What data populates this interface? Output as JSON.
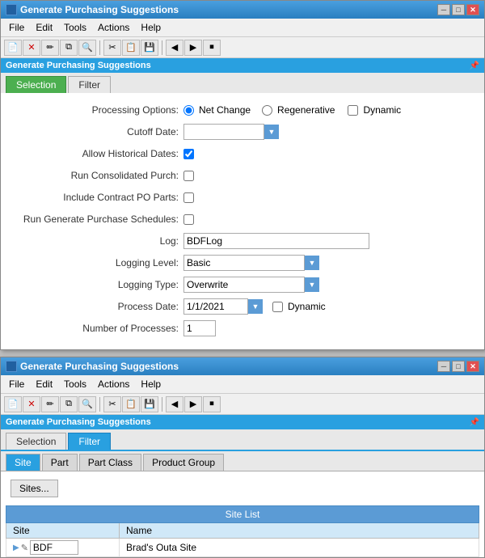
{
  "window1": {
    "title": "Generate Purchasing Suggestions",
    "section_title": "Generate Purchasing Suggestions",
    "tabs": [
      {
        "label": "Selection",
        "active": true,
        "type": "green"
      },
      {
        "label": "Filter",
        "active": false,
        "type": "inactive"
      }
    ],
    "menu": [
      "File",
      "Edit",
      "Tools",
      "Actions",
      "Help"
    ],
    "form": {
      "processing_options_label": "Processing Options:",
      "net_change_label": "Net Change",
      "regenerative_label": "Regenerative",
      "dynamic_label": "Dynamic",
      "cutoff_date_label": "Cutoff Date:",
      "allow_historical_label": "Allow Historical Dates:",
      "run_consolidated_label": "Run Consolidated Purch:",
      "include_contract_label": "Include Contract PO Parts:",
      "run_generate_label": "Run Generate Purchase Schedules:",
      "log_label": "Log:",
      "log_value": "BDFLog",
      "logging_level_label": "Logging Level:",
      "logging_level_value": "Basic",
      "logging_type_label": "Logging Type:",
      "logging_type_value": "Overwrite",
      "process_date_label": "Process Date:",
      "process_date_value": "1/1/2021",
      "process_dynamic_label": "Dynamic",
      "number_of_processes_label": "Number of Processes:",
      "number_of_processes_value": "1"
    }
  },
  "window2": {
    "title": "Generate Purchasing Suggestions",
    "section_title": "Generate Purchasing Suggestions",
    "tabs": [
      {
        "label": "Selection",
        "active": false,
        "type": "inactive"
      },
      {
        "label": "Filter",
        "active": true,
        "type": "cyan"
      }
    ],
    "menu": [
      "File",
      "Edit",
      "Tools",
      "Actions",
      "Help"
    ],
    "inner_tabs": [
      "Site",
      "Part",
      "Part Class",
      "Product Group"
    ],
    "active_inner_tab": "Site",
    "sites_button": "Sites...",
    "table": {
      "header": "Site List",
      "columns": [
        "Site",
        "Name"
      ],
      "rows": [
        {
          "site": "BDF",
          "name": "Brad's Outa Site"
        }
      ]
    }
  },
  "icons": {
    "new": "📄",
    "delete": "✕",
    "edit": "✏",
    "copy": "⧉",
    "paste": "📋",
    "cut": "✂",
    "save": "💾",
    "back": "◀",
    "forward": "▶",
    "stop": "⏹",
    "pin": "📌",
    "dropdown_arrow": "▼",
    "row_arrow": "▶",
    "edit_row": "✎"
  }
}
